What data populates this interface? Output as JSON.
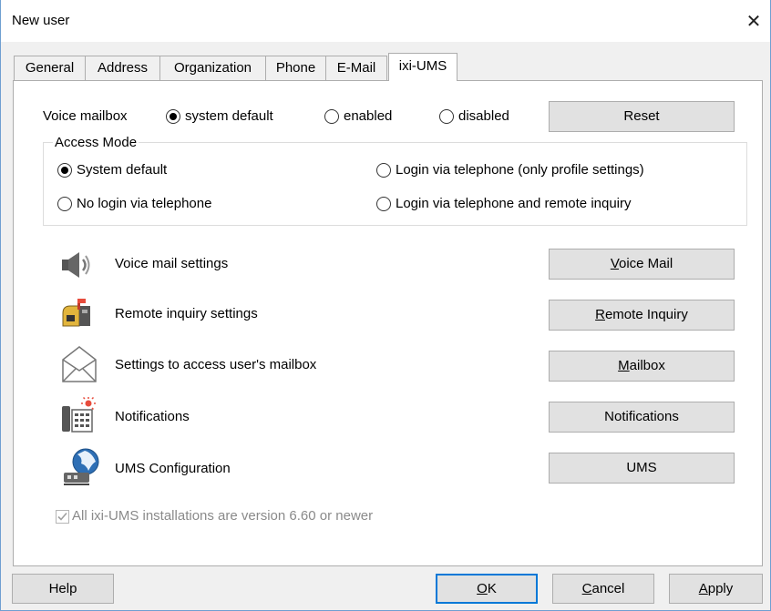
{
  "window": {
    "title": "New user"
  },
  "tabs": [
    {
      "label": "General"
    },
    {
      "label": "Address"
    },
    {
      "label": "Organization"
    },
    {
      "label": "Phone"
    },
    {
      "label": "E-Mail"
    },
    {
      "label": "ixi-UMS",
      "active": true
    }
  ],
  "voice_mailbox": {
    "label": "Voice mailbox",
    "options": [
      "system default",
      "enabled",
      "disabled"
    ],
    "selected": "system default",
    "reset_label": "Reset"
  },
  "access_mode": {
    "label": "Access Mode",
    "options": [
      "System default",
      "No login via telephone",
      "Login via telephone (only profile settings)",
      "Login via telephone and remote inquiry"
    ],
    "selected": "System default"
  },
  "settings": [
    {
      "icon": "speaker-icon",
      "label": "Voice mail settings",
      "button_first": "V",
      "button_rest": "oice Mail"
    },
    {
      "icon": "remote-inquiry-icon",
      "label": "Remote inquiry settings",
      "button_first": "R",
      "button_rest": "emote Inquiry"
    },
    {
      "icon": "envelope-icon",
      "label": "Settings to access user's mailbox",
      "button_first": "M",
      "button_rest": "ailbox"
    },
    {
      "icon": "notifications-phone-icon",
      "label": "Notifications",
      "button_first": "",
      "button_rest": "Notifications"
    },
    {
      "icon": "globe-network-icon",
      "label": "UMS Configuration",
      "button_first": "",
      "button_rest": "UMS"
    }
  ],
  "version_check": {
    "label": "All ixi-UMS installations are version 6.60 or newer",
    "checked": true,
    "disabled": true
  },
  "footer": {
    "help": "Help",
    "ok_first": "O",
    "ok_rest": "K",
    "cancel_first": "C",
    "cancel_rest": "ancel",
    "apply_first": "A",
    "apply_rest": "pply"
  }
}
